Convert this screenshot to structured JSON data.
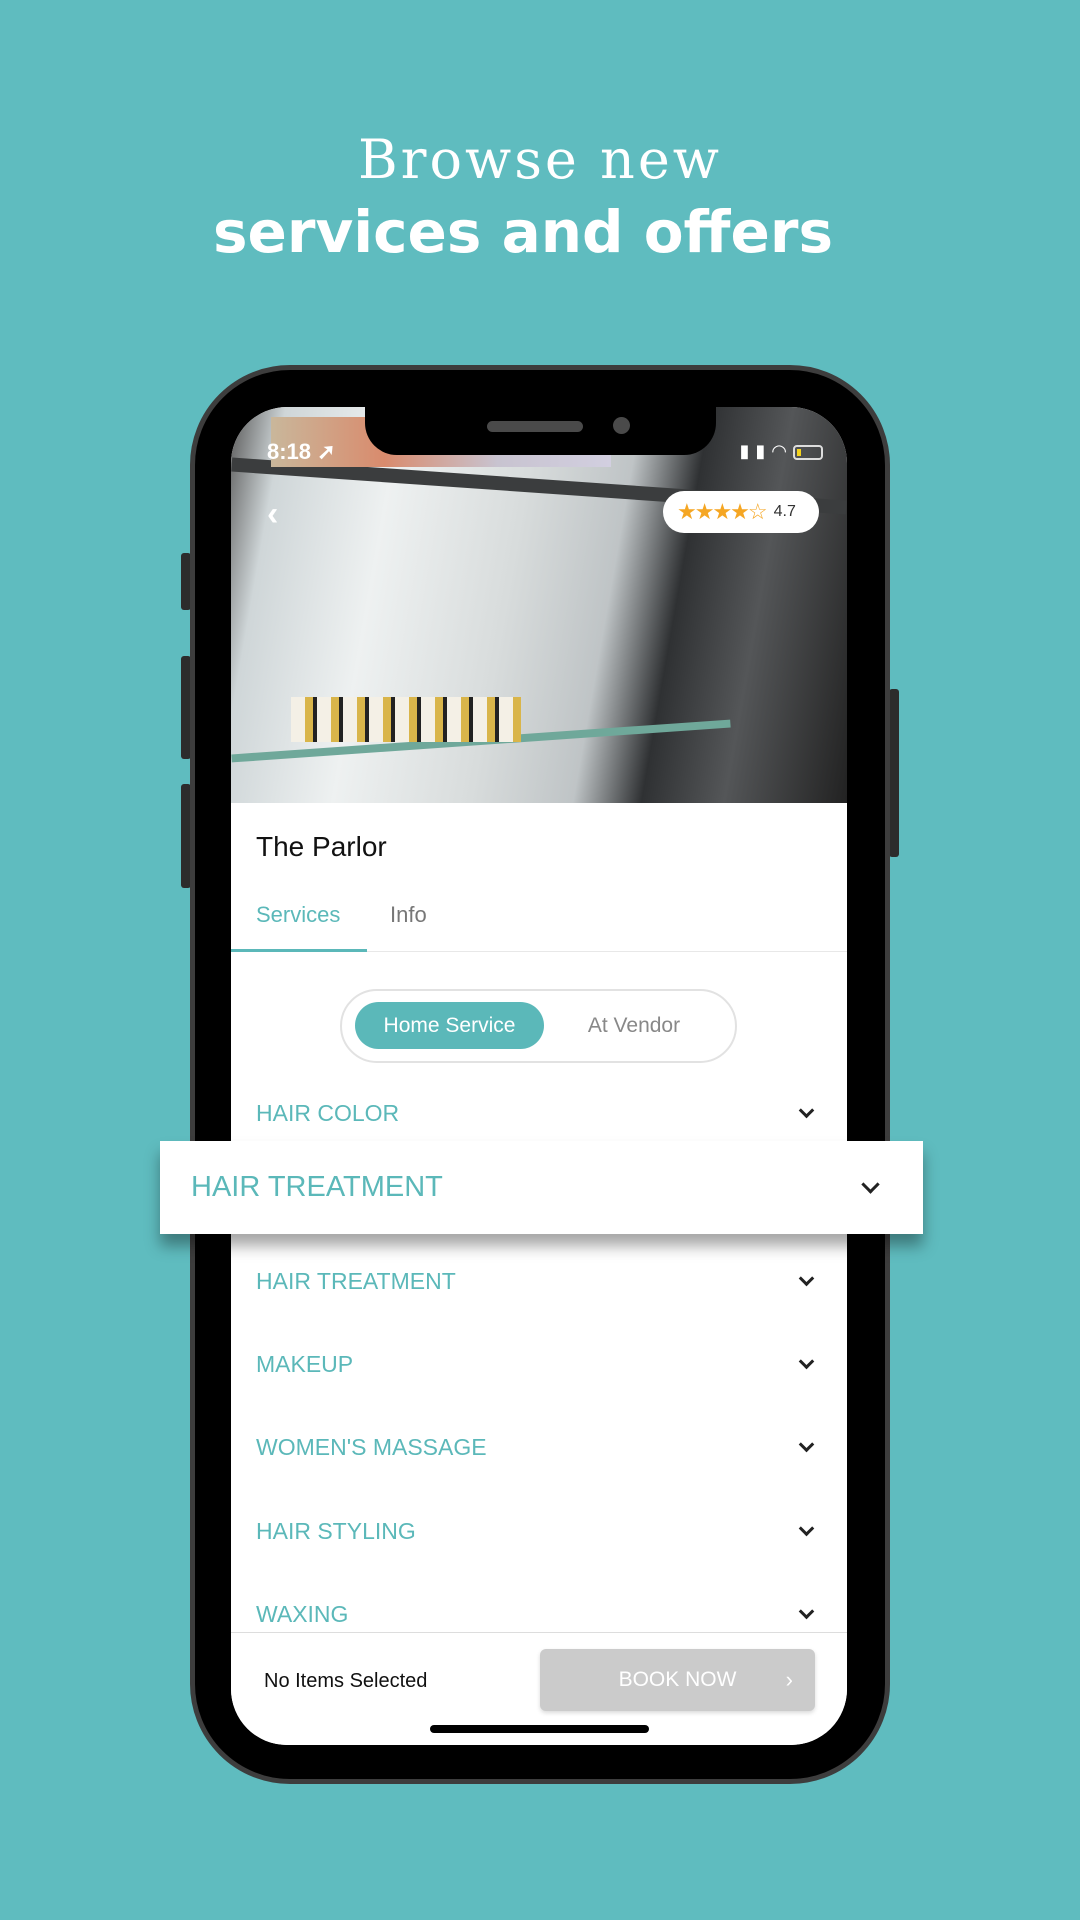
{
  "headline": {
    "line1": "Browse new",
    "line2": "services and offers"
  },
  "status_bar": {
    "time": "8:18",
    "location_icon": "location-arrow-icon",
    "signal_icon": "signal-icon",
    "wifi_icon": "wifi-icon",
    "battery_icon": "battery-icon"
  },
  "vendor": {
    "name": "The Parlor",
    "rating": "4.7",
    "rating_value": 4.7,
    "stars": "★★★★☆"
  },
  "tabs": [
    {
      "label": "Services",
      "active": true
    },
    {
      "label": "Info",
      "active": false
    }
  ],
  "service_toggle": {
    "options": [
      "Home Service",
      "At Vendor"
    ],
    "selected": "Home Service"
  },
  "categories": [
    "HAIR COLOR",
    "HAIR TREATMENT",
    "MAKEUP",
    "WOMEN'S MASSAGE",
    "HAIR STYLING",
    "WAXING"
  ],
  "highlighted_category": "HAIR TREATMENT",
  "footer": {
    "selection_text": "No Items Selected",
    "book_label": "BOOK NOW",
    "book_arrow": "›"
  },
  "colors": {
    "background": "#5fbcbf",
    "accent": "#5bb8b9",
    "button_disabled": "#cbcbcb",
    "star": "#f5a623"
  }
}
